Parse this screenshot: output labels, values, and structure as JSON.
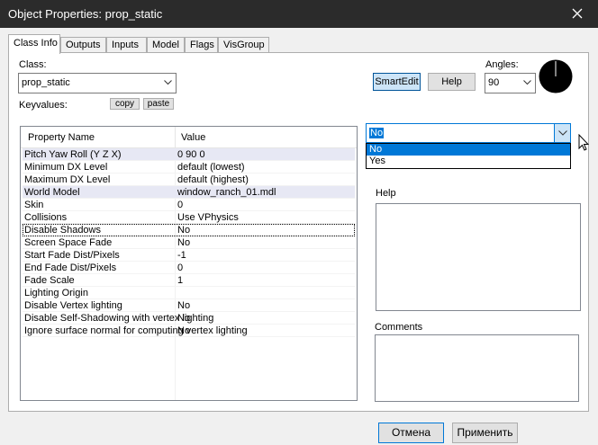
{
  "window": {
    "title": "Object Properties: prop_static"
  },
  "tabs": [
    {
      "label": "Class Info",
      "active": true
    },
    {
      "label": "Outputs"
    },
    {
      "label": "Inputs"
    },
    {
      "label": "Model"
    },
    {
      "label": "Flags"
    },
    {
      "label": "VisGroup"
    }
  ],
  "class_info": {
    "class_label": "Class:",
    "class_value": "prop_static",
    "keyvalues_label": "Keyvalues:",
    "copy_label": "copy",
    "paste_label": "paste",
    "smartedit_label": "SmartEdit",
    "help_button_label": "Help",
    "angles_label": "Angles:",
    "angles_value": "90",
    "help_label": "Help",
    "comments_label": "Comments"
  },
  "grid": {
    "col_name": "Property Name",
    "col_value": "Value",
    "rows": [
      {
        "name": "Pitch Yaw Roll (Y Z X)",
        "value": "0 90 0"
      },
      {
        "name": "Minimum DX Level",
        "value": "default (lowest)"
      },
      {
        "name": "Maximum DX Level",
        "value": "default (highest)"
      },
      {
        "name": "World Model",
        "value": "window_ranch_01.mdl"
      },
      {
        "name": "Skin",
        "value": "0"
      },
      {
        "name": "Collisions",
        "value": "Use VPhysics"
      },
      {
        "name": "Disable Shadows",
        "value": "No"
      },
      {
        "name": "Screen Space Fade",
        "value": "No"
      },
      {
        "name": "Start Fade Dist/Pixels",
        "value": "-1"
      },
      {
        "name": "End Fade Dist/Pixels",
        "value": "0"
      },
      {
        "name": "Fade Scale",
        "value": "1"
      },
      {
        "name": "Lighting Origin",
        "value": ""
      },
      {
        "name": "Disable Vertex lighting",
        "value": "No"
      },
      {
        "name": "Disable Self-Shadowing with vertex lighting",
        "value": "No"
      },
      {
        "name": "Ignore surface normal for computing vertex lighting",
        "value": "No"
      }
    ]
  },
  "value_dropdown": {
    "selected": "No",
    "options": [
      "No",
      "Yes"
    ]
  },
  "footer": {
    "cancel_label": "Отмена",
    "apply_label": "Применить"
  }
}
